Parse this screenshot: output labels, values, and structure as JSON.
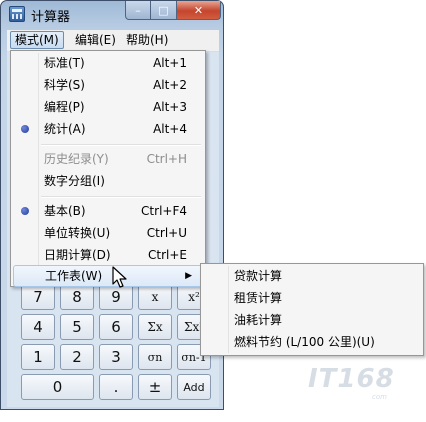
{
  "window": {
    "title": "计算器",
    "caption": {
      "minimize": "–",
      "maximize": "□",
      "close": "✕"
    }
  },
  "menubar": {
    "items": [
      {
        "label": "模式(M)",
        "active": true
      },
      {
        "label": "编辑(E)",
        "active": false
      },
      {
        "label": "帮助(H)",
        "active": false
      }
    ]
  },
  "mode_menu": {
    "items": [
      {
        "label": "标准(T)",
        "shortcut": "Alt+1"
      },
      {
        "label": "科学(S)",
        "shortcut": "Alt+2"
      },
      {
        "label": "编程(P)",
        "shortcut": "Alt+3"
      },
      {
        "label": "统计(A)",
        "shortcut": "Alt+4",
        "checked": true
      },
      {
        "label": "历史纪录(Y)",
        "shortcut": "Ctrl+H",
        "disabled": true
      },
      {
        "label": "数字分组(I)",
        "shortcut": ""
      },
      {
        "label": "基本(B)",
        "shortcut": "Ctrl+F4",
        "checked": true
      },
      {
        "label": "单位转换(U)",
        "shortcut": "Ctrl+U"
      },
      {
        "label": "日期计算(D)",
        "shortcut": "Ctrl+E"
      },
      {
        "label": "工作表(W)",
        "submenu": true,
        "highlighted": true
      }
    ]
  },
  "worksheet_submenu": {
    "items": [
      "贷款计算",
      "租赁计算",
      "油耗计算",
      "燃料节约 (L/100 公里)(U)"
    ]
  },
  "keypad": {
    "row0": [
      "7",
      "8",
      "9",
      "x",
      "x²"
    ],
    "row1": [
      "4",
      "5",
      "6",
      "Σx",
      "Σx²"
    ],
    "row2": [
      "1",
      "2",
      "3",
      "σn",
      "σn-1"
    ],
    "row3": [
      "0",
      ".",
      "±",
      "Add"
    ]
  },
  "watermark": {
    "text": "IT168",
    "sub": "com"
  }
}
